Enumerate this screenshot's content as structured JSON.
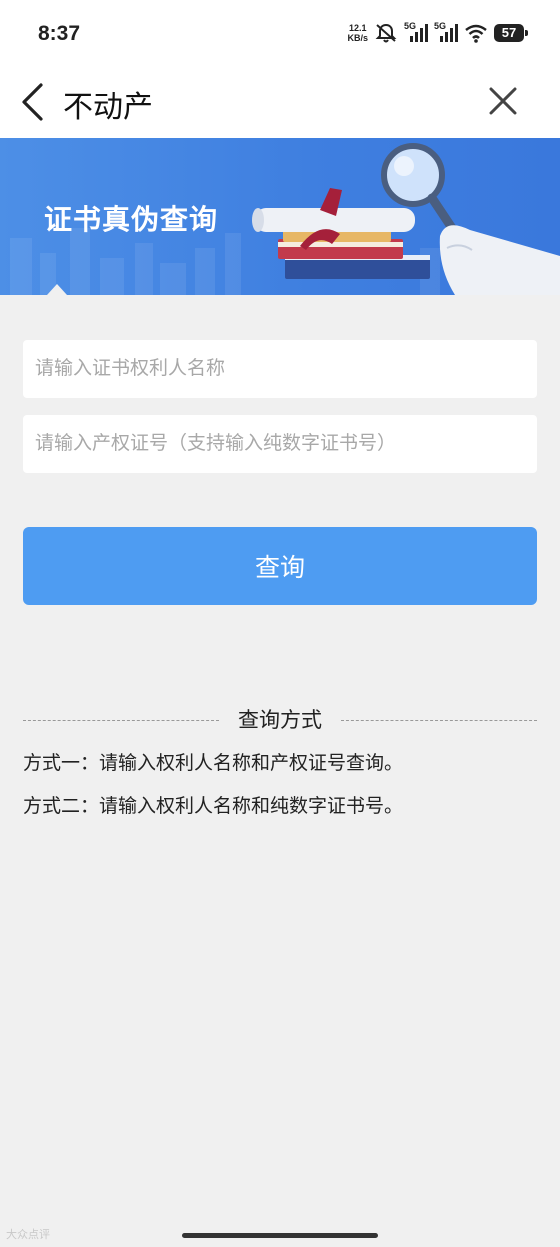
{
  "status_bar": {
    "time": "8:37",
    "net_speed_value": "12.1",
    "net_speed_unit": "KB/s",
    "sim1_label": "5G",
    "sim2_label": "5G",
    "battery": "57"
  },
  "nav": {
    "title": "不动产",
    "back_icon": "chevron-left-icon",
    "close_icon": "close-icon"
  },
  "banner": {
    "title": "证书真伪查询",
    "accent": "#3f7fe0"
  },
  "form": {
    "owner_name_placeholder": "请输入证书权利人名称",
    "cert_number_placeholder": "请输入产权证号（支持输入纯数字证书号）",
    "query_button": "查询",
    "button_color": "#4e9cf2"
  },
  "methods": {
    "heading": "查询方式",
    "items": [
      "方式一：请输入权利人名称和产权证号查询。",
      "方式二：请输入权利人名称和纯数字证书号。"
    ]
  },
  "watermark": "大众点评"
}
